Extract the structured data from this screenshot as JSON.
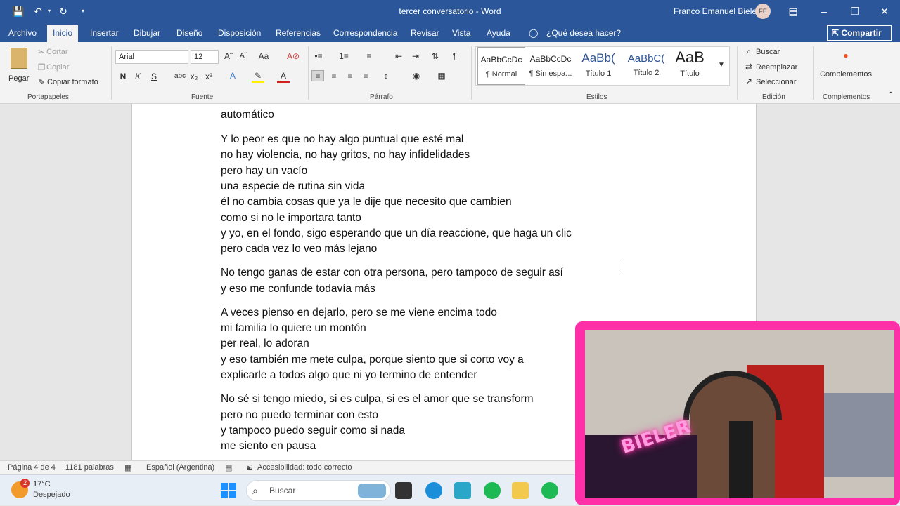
{
  "titlebar": {
    "doc_title": "tercer conversatorio - Word",
    "user": "Franco Emanuel Bieler",
    "avatar_initials": "FE"
  },
  "menu": {
    "items": [
      "Archivo",
      "Inicio",
      "Insertar",
      "Dibujar",
      "Diseño",
      "Disposición",
      "Referencias",
      "Correspondencia",
      "Revisar",
      "Vista",
      "Ayuda"
    ],
    "tell_me": "¿Qué desea hacer?",
    "share": "Compartir"
  },
  "ribbon": {
    "clipboard": {
      "paste": "Pegar",
      "cut": "Cortar",
      "copy": "Copiar",
      "format_painter": "Copiar formato",
      "label": "Portapapeles"
    },
    "font": {
      "name": "Arial",
      "size": "12",
      "label": "Fuente"
    },
    "paragraph": {
      "label": "Párrafo"
    },
    "styles": {
      "label": "Estilos",
      "items": [
        {
          "preview": "AaBbCcDc",
          "name": "¶ Normal"
        },
        {
          "preview": "AaBbCcDc",
          "name": "¶ Sin espa..."
        },
        {
          "preview": "AaBb(",
          "name": "Título 1"
        },
        {
          "preview": "AaBbC(",
          "name": "Título 2"
        },
        {
          "preview": "AaB",
          "name": "Título"
        }
      ]
    },
    "editing": {
      "find": "Buscar",
      "replace": "Reemplazar",
      "select": "Seleccionar",
      "label": "Edición"
    },
    "addins": {
      "button": "Complementos",
      "label": "Complementos"
    }
  },
  "document": {
    "lines": [
      "automático",
      "Y lo peor es que no hay algo puntual que esté mal",
      "no hay violencia, no hay gritos, no hay infidelidades",
      "pero hay un vacío",
      "una especie de rutina sin vida",
      "él no cambia cosas que ya le dije que necesito que cambien",
      "como si no le importara tanto",
      "y yo, en el fondo, sigo esperando que un día reaccione, que haga un clic",
      "pero cada vez lo veo más lejano",
      "No tengo ganas de estar con otra persona, pero tampoco de seguir así",
      "y eso me confunde todavía más",
      "A veces pienso en dejarlo, pero se me viene encima todo",
      "mi familia lo quiere un montón",
      "per real, lo adoran",
      "y eso también me mete culpa, porque siento que si corto voy a",
      "explicarle a todos algo que ni yo termino de entender",
      "No sé si tengo miedo, si es culpa, si es el amor que se transform",
      "pero no puedo terminar con esto",
      "y tampoco puedo seguir como si nada",
      "me siento en pausa"
    ]
  },
  "status": {
    "page": "Página 4 de 4",
    "words": "1181 palabras",
    "language": "Español (Argentina)",
    "accessibility": "Accesibilidad: todo correcto"
  },
  "taskbar": {
    "weather_temp": "17°C",
    "weather_desc": "Despejado",
    "weather_badge": "2",
    "search_placeholder": "Buscar"
  },
  "webcam": {
    "sign_text": "BIELER"
  },
  "colors": {
    "word_blue": "#2b579a",
    "webcam_frame": "#ff2fa8"
  }
}
